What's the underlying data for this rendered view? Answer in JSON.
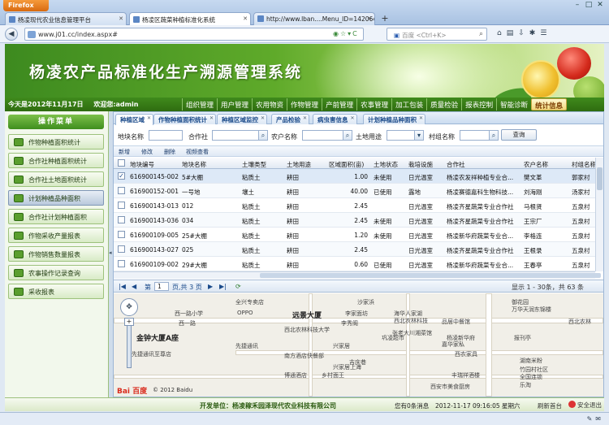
{
  "browser": {
    "firefox_label": "Firefox",
    "tabs": [
      {
        "label": "杨凌现代农业信息管理平台"
      },
      {
        "label": "杨凌区蔬菜种植标准化系统"
      },
      {
        "label": "http://www.lban....Menu_ID=142064"
      }
    ],
    "new_tab": "+",
    "url": "www.j01.cc/index.aspx#",
    "search_placeholder": "百度 <Ctrl+K>"
  },
  "app": {
    "title": "杨凌农产品标准化生产溯源管理系统",
    "date_text": "今天是2012年11月17日",
    "welcome_text": "欢迎您:admin",
    "menu": [
      "组织管理",
      "用户管理",
      "农用物资",
      "作物管理",
      "产前管理",
      "农事管理",
      "加工包装",
      "质量检验",
      "报表控制",
      "智能诊断",
      "统计信息"
    ],
    "left_menu_title": "操作菜单",
    "left_menu": [
      "作物种植面积统计",
      "合作社种植面积统计",
      "合作社土地面积统计",
      "计划种植品种面积",
      "合作社计划种植面积",
      "作物采收产量报表",
      "作物销售数量报表",
      "农事操作记录查询",
      "采收报表"
    ],
    "sub_tabs": [
      "种植区域",
      "作物种植面积统计",
      "种植区域监控",
      "产品检验",
      "病虫害信息",
      "计划种植品种面积"
    ],
    "filters": {
      "base_name": "地块名称",
      "coop": "合作社",
      "farmer": "农户名称",
      "land_use": "土地用途",
      "village": "村组名称",
      "query_button": "查询"
    },
    "toolbar": [
      "新增",
      "修改",
      "删除",
      "视频查看"
    ],
    "grid": {
      "headers": [
        "地块编号",
        "地块名称",
        "土壤类型",
        "土地用途",
        "区域面积(亩)",
        "土地状态",
        "栽培设施",
        "合作社",
        "农户名称",
        "村组名称"
      ],
      "rows": [
        [
          "616900145-002",
          "5#大棚",
          "粘质土",
          "耕田",
          "1.00",
          "未使用",
          "日光温室",
          "杨凌农发祥种植专业合...",
          "樊文革",
          "郭家村"
        ],
        [
          "616900152-001",
          "一号地",
          "壤土",
          "耕田",
          "40.00",
          "已使用",
          "露地",
          "杨凌赛德嘉科生物科技...",
          "刘海刚",
          "汤家村"
        ],
        [
          "616900143-013",
          "012",
          "粘质土",
          "耕田",
          "2.45",
          "",
          "日光温室",
          "杨凌齐星蔬菜专业合作社",
          "马根贤",
          "五泉村"
        ],
        [
          "616900143-036",
          "034",
          "粘质土",
          "耕田",
          "2.45",
          "未使用",
          "日光温室",
          "杨凌齐星蔬菜专业合作社",
          "王宗厂",
          "五泉村"
        ],
        [
          "616900109-005",
          "25#大棚",
          "粘质土",
          "耕田",
          "1.20",
          "未使用",
          "日光温室",
          "杨凌新华府蔬菜专业合...",
          "李格连",
          "五泉村"
        ],
        [
          "616900143-027",
          "025",
          "粘质土",
          "耕田",
          "2.45",
          "",
          "日光温室",
          "杨凌齐星蔬菜专业合作社",
          "王根录",
          "五泉村"
        ],
        [
          "616900109-002",
          "29#大棚",
          "粘质土",
          "耕田",
          "0.60",
          "已使用",
          "日光温室",
          "杨凌新华府蔬菜专业合...",
          "王春亭",
          "五泉村"
        ]
      ],
      "checked_row": 0
    },
    "pager": {
      "page_label": "第",
      "page_value": "1",
      "of_text": "页,共 3 页",
      "display_text": "显示 1 - 30条，共 63 条"
    },
    "map": {
      "labels": [
        "西一路小学",
        "OPPO",
        "远景大厦",
        "西一路",
        "金钟大厦A座",
        "西北农林科技大学",
        "李家面坊",
        "海华人家湖",
        "西北农林科技",
        "巩凌超市",
        "杨凌新华府",
        "博通酒店",
        "乡村面王",
        "吉庆巷",
        "南方酒店快餐部",
        "御花园",
        "万华天润东锦楼",
        "报刊亭",
        "湖南米粉",
        "竹园村社区",
        "全国连锁",
        "乐淘",
        "丰瑞祥酒楼",
        "品居中餐馆",
        "嘉华家私",
        "张老大川湘菜馆",
        "西农家具",
        "西北农林",
        "全兴专卖店",
        "先捷通讯",
        "先捷通讯至尊店",
        "兴家居",
        "李秀阁",
        "兴家居上海",
        "沙家浜",
        "西安市美食厨房"
      ],
      "copyright": "© 2012 Baidu",
      "logo": "Bai 百度"
    },
    "footer": {
      "developer": "开发单位：杨凌稼禾园泽现代农业科技有限公司",
      "messages": "您有0条消息",
      "clock": "2012-11-17 09:16:05 星期六",
      "refresh": "刷新首台",
      "logout": "安全退出"
    }
  },
  "colors": {
    "brand_green": "#3f8a1c",
    "menu_active": "#f1d87c",
    "grid_header": "#e1e9f3"
  }
}
